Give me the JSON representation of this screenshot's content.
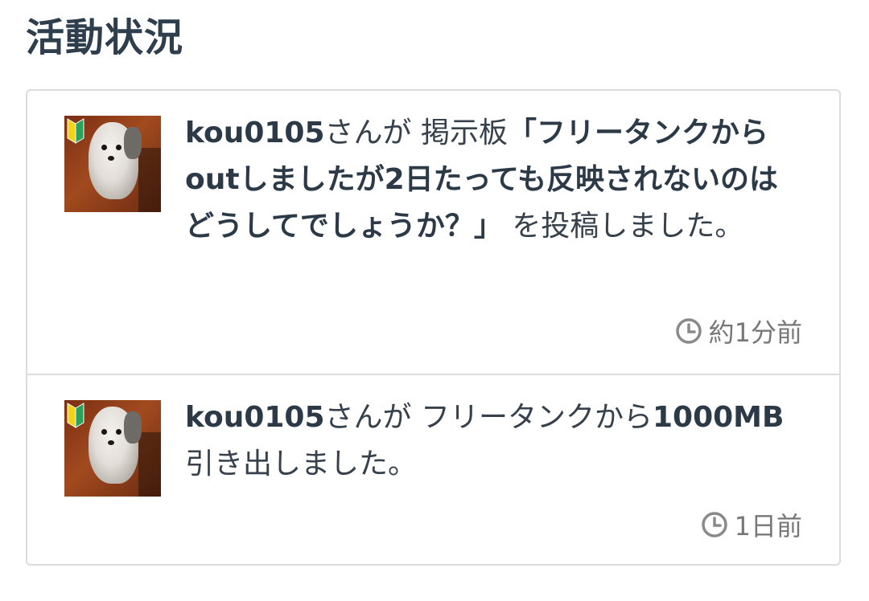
{
  "section": {
    "title": "活動状況"
  },
  "activities": [
    {
      "user": "kou0105",
      "suffix": "さんが 掲示板",
      "highlight": "「フリータンクからoutしましたが2日たっても反映されないのはどうしてでしょうか？」",
      "action": " を投稿しました。",
      "time": "約1分前",
      "avatar_icon": "dog-avatar",
      "badge_icon": "beginner-mark-icon"
    },
    {
      "user": "kou0105",
      "suffix": "さんが フリータンクから",
      "highlight": "1000MB",
      "action": " 引き出しました。",
      "time": "1日前",
      "avatar_icon": "dog-avatar",
      "badge_icon": "beginner-mark-icon"
    }
  ],
  "colors": {
    "title": "#2f3e4c",
    "border": "#dcdcdc",
    "time": "#777777"
  }
}
